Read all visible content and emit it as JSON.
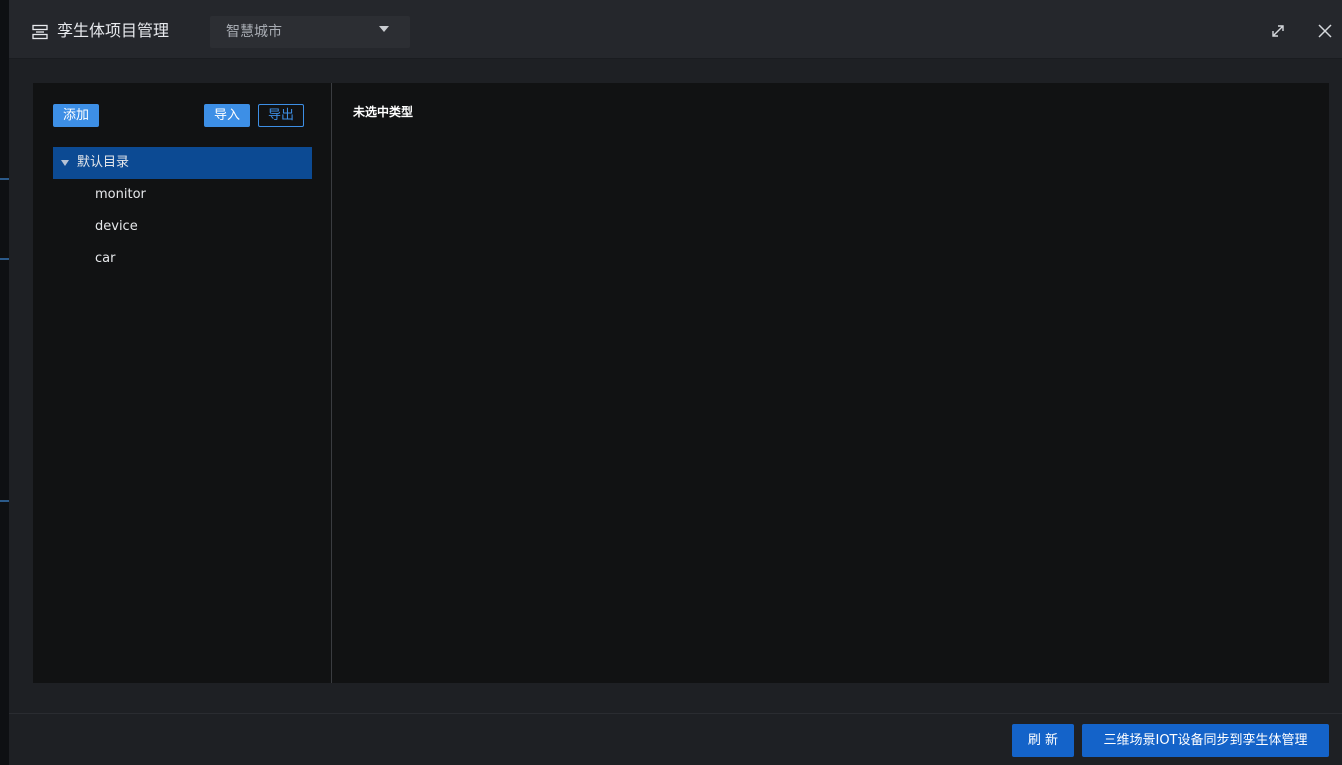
{
  "header": {
    "title": "孪生体项目管理",
    "title_icon": "list-panel-icon",
    "project_select": {
      "value": "智慧城市"
    },
    "maximize_icon": "expand-arrows-icon",
    "close_icon": "close-icon"
  },
  "toolbar": {
    "add_label": "添加",
    "import_label": "导入",
    "export_label": "导出"
  },
  "tree": {
    "root": {
      "label": "默认目录",
      "expanded": true,
      "selected": true
    },
    "children": [
      {
        "label": "monitor"
      },
      {
        "label": "device"
      },
      {
        "label": "car"
      }
    ]
  },
  "detail": {
    "empty_text": "未选中类型"
  },
  "footer": {
    "refresh_label": "刷 新",
    "sync_label": "三维场景IOT设备同步到孪生体管理"
  },
  "colors": {
    "accent": "#3d8fe6",
    "selected_row": "#0c4a93",
    "footer_button": "#1463c9"
  }
}
